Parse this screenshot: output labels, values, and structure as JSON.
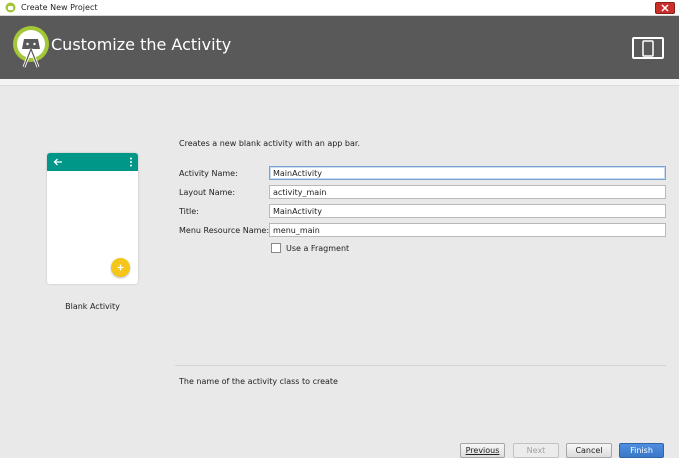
{
  "window": {
    "title": "Create New Project"
  },
  "header": {
    "title": "Customize the Activity"
  },
  "preview": {
    "template_name": "Blank Activity"
  },
  "form": {
    "description": "Creates a new blank activity with an app bar.",
    "fields": [
      {
        "label": "Activity Name:",
        "value": "MainActivity"
      },
      {
        "label": "Layout Name:",
        "value": "activity_main"
      },
      {
        "label": "Title:",
        "value": "MainActivity"
      },
      {
        "label": "Menu Resource Name:",
        "value": "menu_main"
      }
    ],
    "fragment_checkbox": {
      "label": "Use a Fragment",
      "checked": false
    },
    "hint": "The name of the activity class to create"
  },
  "buttons": {
    "previous": "Previous",
    "next": "Next",
    "cancel": "Cancel",
    "finish": "Finish"
  },
  "colors": {
    "header_bg": "#595959",
    "appbar": "#009688",
    "fab": "#f5c518",
    "android_green": "#a4c639",
    "primary_button": "#3a78c8"
  },
  "icons": {
    "title_bar": "android-studio-icon",
    "logo": "android-studio-logo",
    "devices": "devices-icon",
    "back": "arrow-back-icon",
    "overflow": "more-vert-icon",
    "fab": "add-icon"
  }
}
